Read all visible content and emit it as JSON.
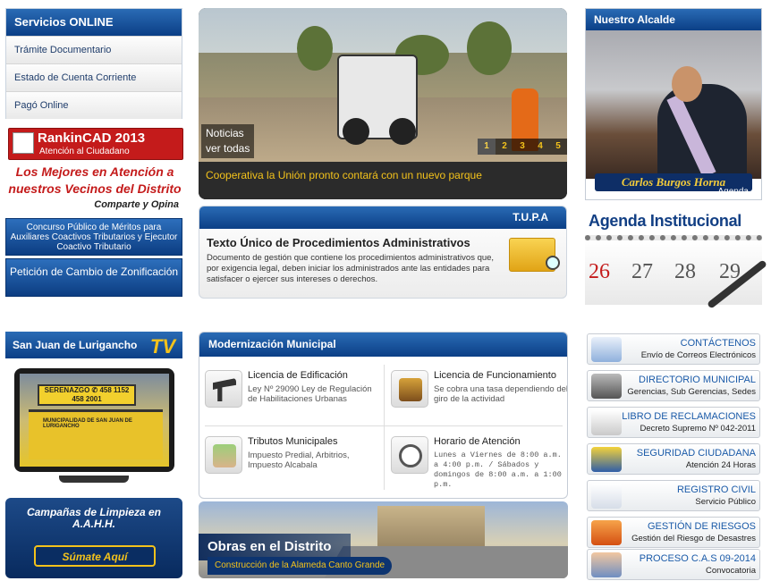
{
  "services": {
    "title": "Servicios ONLINE",
    "items": [
      "Trámite Documentario",
      "Estado de Cuenta Corriente",
      "Pagó Online"
    ]
  },
  "rankin": {
    "title": "RankinCAD 2013",
    "subtitle": "Atención al Ciudadano",
    "line1": "Los Mejores en Atención a",
    "line2": "nuestros Vecinos del Distrito",
    "share": "Comparte y Opina"
  },
  "left_buttons": {
    "concurso": "Concurso Público de Méritos para Auxiliares Coactivos Tributarios y Ejecutor Coactivo Tributario",
    "peticion": "Petición de Cambio de Zonificación"
  },
  "slider": {
    "noticias": "Noticias",
    "ver_todas": "ver todas",
    "pages": [
      "1",
      "2",
      "3",
      "4",
      "5"
    ],
    "active_page": "1",
    "caption": "Cooperativa la Unión pronto contará con un nuevo parque"
  },
  "tupa": {
    "band": "T.U.P.A",
    "title": "Texto Único de Procedimientos Administrativos",
    "desc": "Documento de gestión que contiene los procedimientos administrativos que, por exigencia legal, deben iniciar los administrados ante las entidades para satisfacer o ejercer sus intereses o derechos."
  },
  "alcalde": {
    "title": "Nuestro Alcalde",
    "name": "Carlos Burgos Horna",
    "agenda": "Agenda"
  },
  "agenda_inst": {
    "title": "Agenda Institucional",
    "days": [
      "26",
      "27",
      "28",
      "29"
    ]
  },
  "tv": {
    "title": "San Juan de Lurigancho",
    "badge": "TV",
    "sign": "SERENAZGO ✆ 458 1152  458 2001",
    "building": "MUNICIPALIDAD DE SAN JUAN DE LURIGANCHO"
  },
  "campanas": {
    "title": "Campañas de Limpieza en A.A.H.H.",
    "button": "Súmate Aquí"
  },
  "modernizacion": {
    "title": "Modernización Municipal",
    "items": [
      {
        "title": "Licencia de Edificación",
        "desc": "Ley Nº 29090 Ley de Regulación de Habilitaciones Urbanas"
      },
      {
        "title": "Licencia de Funcionamiento",
        "desc": "Se cobra una tasa dependiendo del giro de la actividad"
      },
      {
        "title": "Tributos Municipales",
        "desc": "Impuesto Predial, Arbitrios, Impuesto Alcabala"
      },
      {
        "title": "Horario de Atención",
        "desc": "Lunes a Viernes de 8:00 a.m. a 4:00 p.m. / Sábados y domingos de 8:00 a.m. a 1:00 p.m."
      }
    ]
  },
  "obras": {
    "title": "Obras en el Distrito",
    "sub": "Construcción de la Alameda Canto Grande"
  },
  "right_links": [
    {
      "title": "CONTÁCTENOS",
      "sub": "Envío de Correos Electrónicos"
    },
    {
      "title": "DIRECTORIO MUNICIPAL",
      "sub": "Gerencias, Sub Gerencias, Sedes"
    },
    {
      "title": "LIBRO DE RECLAMACIONES",
      "sub": "Decreto Supremo Nº 042-2011"
    },
    {
      "title": "SEGURIDAD CIUDADANA",
      "sub": "Atención 24 Horas"
    },
    {
      "title": "REGISTRO CIVIL",
      "sub": "Servicio Público"
    },
    {
      "title": "GESTIÓN DE RIESGOS",
      "sub": "Gestión del Riesgo de Desastres"
    },
    {
      "title": "PROCESO C.A.S 09-2014",
      "sub": "Convocatoria"
    }
  ],
  "colors": {
    "brand_blue": "#0b3f86",
    "accent_yellow": "#f3c21b",
    "accent_red": "#c41b1b"
  }
}
